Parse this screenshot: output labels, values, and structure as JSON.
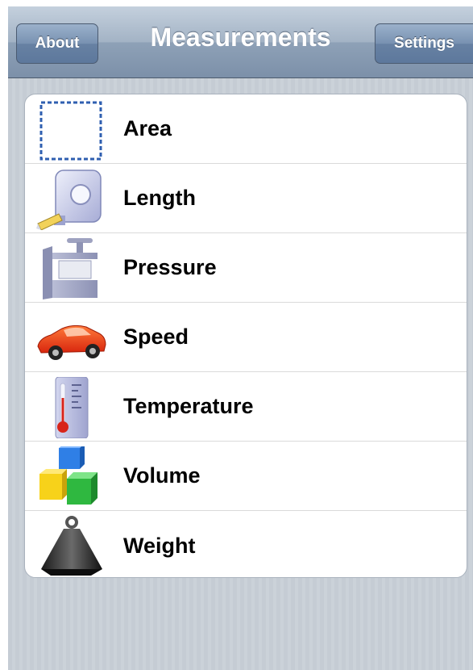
{
  "navbar": {
    "title": "Measurements",
    "left_button": "About",
    "right_button": "Settings"
  },
  "categories": [
    {
      "label": "Area",
      "icon": "dashed-square-icon"
    },
    {
      "label": "Length",
      "icon": "tape-measure-icon"
    },
    {
      "label": "Pressure",
      "icon": "press-icon"
    },
    {
      "label": "Speed",
      "icon": "red-car-icon"
    },
    {
      "label": "Temperature",
      "icon": "thermometer-icon"
    },
    {
      "label": "Volume",
      "icon": "cubes-icon"
    },
    {
      "label": "Weight",
      "icon": "weight-icon"
    }
  ],
  "colors": {
    "navbar": "#8ea1b7",
    "background": "#c5ccd4",
    "list": "#ffffff"
  }
}
